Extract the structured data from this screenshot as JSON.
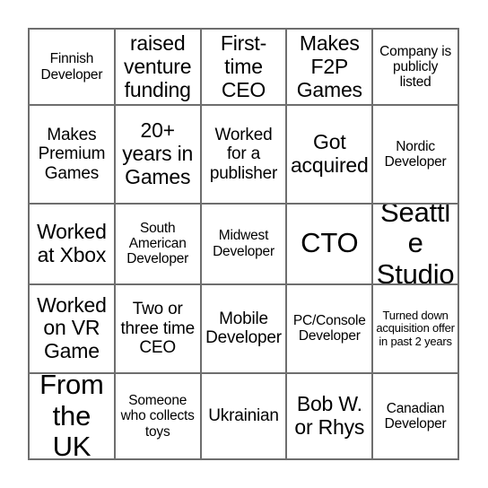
{
  "card": {
    "title": "Bingo Card",
    "columns": 5,
    "rows": 5,
    "grid_line_color": "#6e6e6e",
    "background_color": "#ffffff",
    "text_color": "#000000",
    "cells": [
      [
        {
          "text": "Finnish Developer",
          "size": "sm"
        },
        {
          "text": "raised venture funding",
          "size": "lg"
        },
        {
          "text": "First-time CEO",
          "size": "lg"
        },
        {
          "text": "Makes F2P Games",
          "size": "lg"
        },
        {
          "text": "Company is publicly listed",
          "size": "sm"
        }
      ],
      [
        {
          "text": "Makes Premium Games",
          "size": "md"
        },
        {
          "text": "20+ years in Games",
          "size": "lg"
        },
        {
          "text": "Worked for a publisher",
          "size": "md"
        },
        {
          "text": "Got acquired",
          "size": "lg"
        },
        {
          "text": "Nordic Developer",
          "size": "sm"
        }
      ],
      [
        {
          "text": "Worked at Xbox",
          "size": "lg"
        },
        {
          "text": "South American Developer",
          "size": "sm"
        },
        {
          "text": "Midwest Developer",
          "size": "sm"
        },
        {
          "text": "CTO",
          "size": "xl"
        },
        {
          "text": "Seattle Studio",
          "size": "xl"
        }
      ],
      [
        {
          "text": "Worked on VR Game",
          "size": "lg"
        },
        {
          "text": "Two or three time CEO",
          "size": "md"
        },
        {
          "text": "Mobile Developer",
          "size": "md"
        },
        {
          "text": "PC/Console Developer",
          "size": "sm"
        },
        {
          "text": "Turned down acquisition offer in past 2 years",
          "size": "xs"
        }
      ],
      [
        {
          "text": "From the UK",
          "size": "xl"
        },
        {
          "text": "Someone who collects toys",
          "size": "sm"
        },
        {
          "text": "Ukrainian",
          "size": "md"
        },
        {
          "text": "Bob W. or Rhys",
          "size": "lg"
        },
        {
          "text": "Canadian Developer",
          "size": "sm"
        }
      ]
    ]
  }
}
